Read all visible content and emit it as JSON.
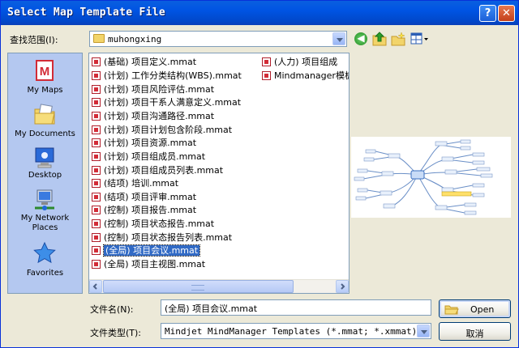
{
  "window": {
    "title": "Select Map Template File"
  },
  "look_in": {
    "label": "查找范围(I):",
    "value": "muhongxing"
  },
  "toolbar_icons": [
    "back-icon",
    "up-folder-icon",
    "new-folder-icon",
    "view-menu-icon"
  ],
  "places": [
    {
      "label": "My Maps",
      "icon": "mindmanager-maps-icon"
    },
    {
      "label": "My Documents",
      "icon": "documents-folder-icon"
    },
    {
      "label": "Desktop",
      "icon": "desktop-icon"
    },
    {
      "label": "My Network Places",
      "icon": "network-icon"
    },
    {
      "label": "Favorites",
      "icon": "star-icon"
    }
  ],
  "files_col1": [
    "(基础) 项目定义.mmat",
    "(计划) 工作分类结构(WBS).mmat",
    "(计划) 项目风险评估.mmat",
    "(计划) 项目干系人满意定义.mmat",
    "(计划) 项目沟通路径.mmat",
    "(计划) 项目计划包含阶段.mmat",
    "(计划) 项目资源.mmat",
    "(计划) 项目组成员.mmat",
    "(计划) 项目组成员列表.mmat",
    "(结项) 培训.mmat",
    "(结项) 项目评审.mmat",
    "(控制) 项目报告.mmat",
    "(控制) 项目状态报告.mmat",
    "(控制) 项目状态报告列表.mmat",
    "(全局) 项目会议.mmat",
    "(全局) 项目主视图.mmat"
  ],
  "files_col2": [
    "(人力) 项目组成",
    "Mindmanager模板"
  ],
  "selected_file": "(全局) 项目会议.mmat",
  "filename": {
    "label": "文件名(N):",
    "value": "(全局) 项目会议.mmat"
  },
  "filetype": {
    "label": "文件类型(T):",
    "value": "Mindjet MindManager Templates (*.mmat; *.xmmat)"
  },
  "buttons": {
    "open": "Open",
    "cancel": "取消"
  },
  "colors": {
    "title_bar": "#0054e3",
    "selection": "#316ac5",
    "places_bar": "#b4c8f0",
    "dialog_bg": "#ece9d8"
  }
}
